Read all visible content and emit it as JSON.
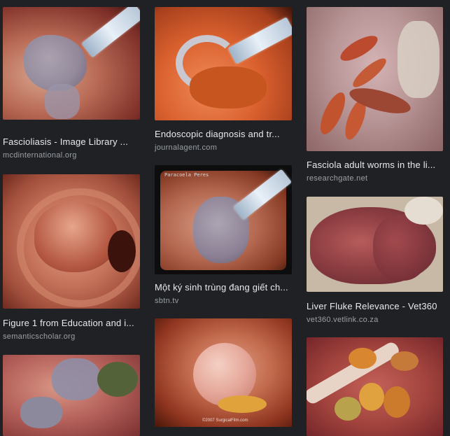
{
  "results": [
    {
      "title": "Fascioliasis - Image Library ...",
      "source": "mcdinternational.org"
    },
    {
      "title": "Figure 1 from Education and i...",
      "source": "semanticscholar.org"
    },
    {
      "title": "Endoscopic diagnosis and tr...",
      "source": "journalagent.com"
    },
    {
      "title": "Một ký sinh trùng đang giết ch...",
      "source": "sbtn.tv"
    },
    {
      "title": "Fasciola adult worms in the li...",
      "source": "researchgate.net"
    },
    {
      "title": "Liver Fluke Relevance - Vet360",
      "source": "vet360.vetlink.co.za"
    }
  ],
  "image_overlays": {
    "endoscope_id_text": "Paracoela Peres",
    "watermark": "©2007 SurgicalFilm.com"
  },
  "colors": {
    "background": "#202124",
    "title_text": "#e8eaed",
    "source_text": "#9aa0a6"
  }
}
